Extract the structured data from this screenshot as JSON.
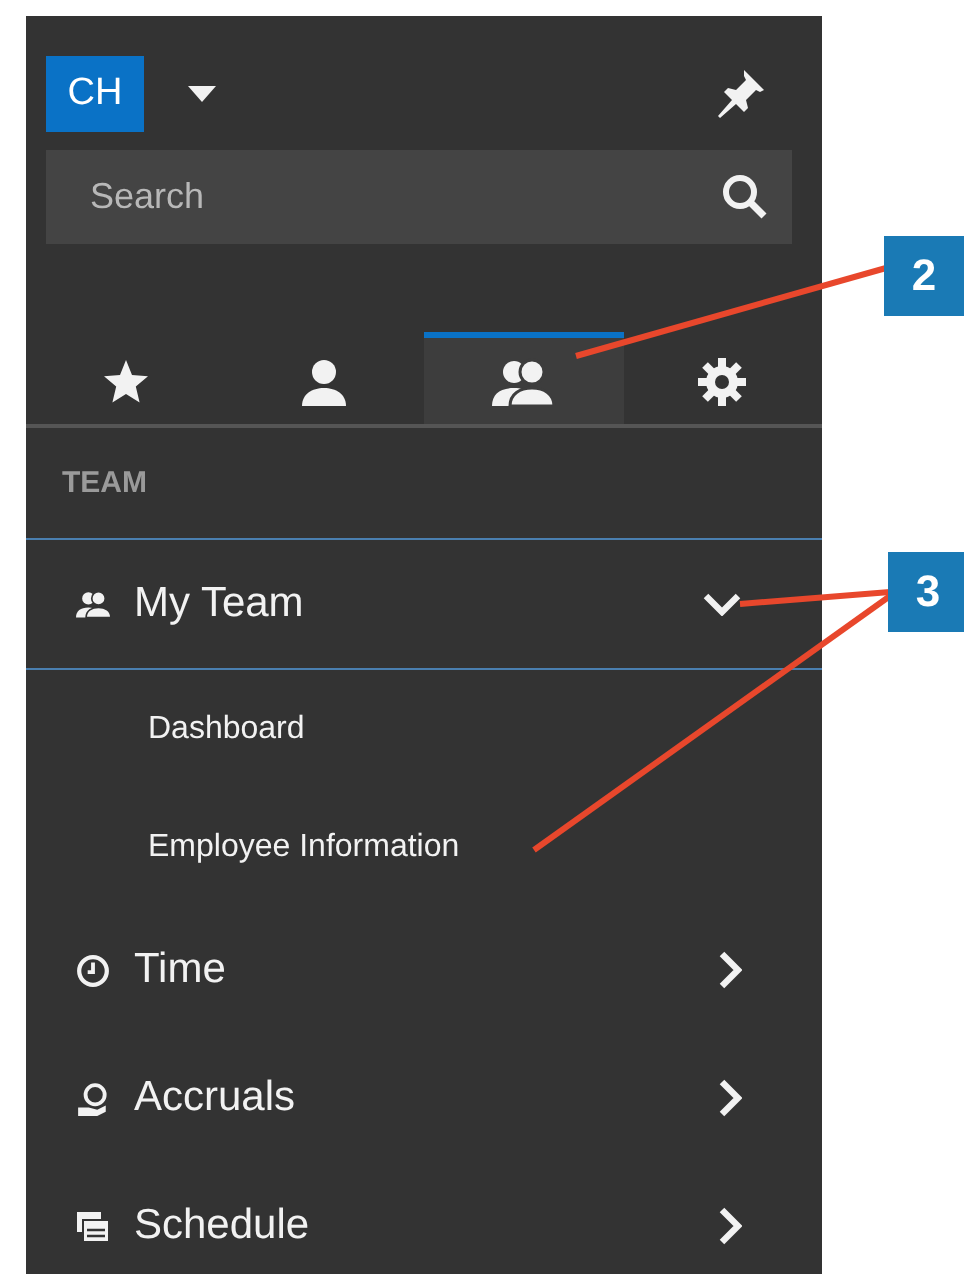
{
  "user": {
    "initials": "CH"
  },
  "search": {
    "placeholder": "Search"
  },
  "tabs": [
    {
      "selected": false
    },
    {
      "selected": false
    },
    {
      "selected": true
    },
    {
      "selected": false
    }
  ],
  "section_label": "TEAM",
  "menu": [
    {
      "label": "My Team",
      "expanded": true,
      "children": [
        {
          "label": "Dashboard"
        },
        {
          "label": "Employee Information"
        }
      ]
    },
    {
      "label": "Time",
      "expanded": false
    },
    {
      "label": "Accruals",
      "expanded": false
    },
    {
      "label": "Schedule",
      "expanded": false
    }
  ],
  "callouts": [
    {
      "number": "2"
    },
    {
      "number": "3"
    }
  ]
}
